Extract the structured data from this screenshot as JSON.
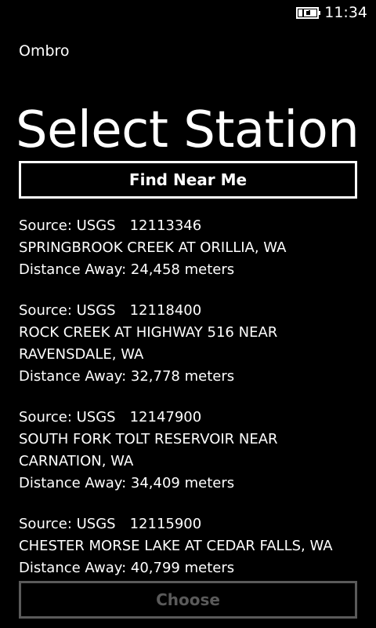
{
  "status": {
    "time": "11:34",
    "icon": "battery-charging-icon"
  },
  "header": {
    "app_name": "Ombro",
    "title": "Select Station"
  },
  "actions": {
    "find_label": "Find Near Me",
    "choose_label": "Choose"
  },
  "colors": {
    "background": "#000000",
    "foreground": "#ffffff",
    "disabled": "#5a5a5a"
  },
  "stations": [
    {
      "source": "Source: USGS",
      "id": "12113346",
      "name": "SPRINGBROOK CREEK AT ORILLIA, WA",
      "distance": "Distance Away: 24,458 meters"
    },
    {
      "source": "Source: USGS",
      "id": "12118400",
      "name": "ROCK CREEK AT HIGHWAY 516 NEAR RAVENSDALE, WA",
      "distance": "Distance Away: 32,778 meters"
    },
    {
      "source": "Source: USGS",
      "id": "12147900",
      "name": "SOUTH FORK TOLT RESERVOIR NEAR CARNATION, WA",
      "distance": "Distance Away: 34,409 meters"
    },
    {
      "source": "Source: USGS",
      "id": "12115900",
      "name": "CHESTER MORSE LAKE AT CEDAR FALLS, WA",
      "distance": "Distance Away: 40,799 meters"
    }
  ]
}
